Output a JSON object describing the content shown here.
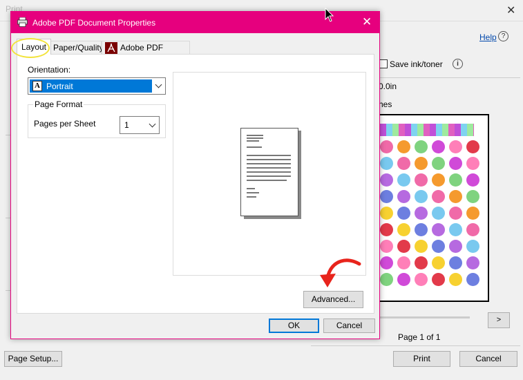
{
  "print_dialog": {
    "title": "Print",
    "close_symbol": "✕",
    "help_label": "Help",
    "help_icon": "?",
    "save_ink_label": "Save ink/toner",
    "info_icon": "i",
    "size_line1": "0.0in",
    "size_line2": "hes",
    "next_label": ">",
    "page_info": "Page 1 of 1",
    "page_setup_label": "Page Setup...",
    "print_label": "Print",
    "cancel_label": "Cancel"
  },
  "pdf_dialog": {
    "title": "Adobe PDF Document Properties",
    "close_symbol": "✕",
    "tabs": [
      {
        "label": "Layout",
        "active": true
      },
      {
        "label": "Paper/Quality",
        "active": false
      },
      {
        "label": "Adobe PDF Settings",
        "active": false
      }
    ],
    "orientation_label": "Orientation:",
    "orientation_icon_letter": "A",
    "orientation_value": "Portrait",
    "page_format_label": "Page Format",
    "pages_per_sheet_label": "Pages per Sheet",
    "pages_per_sheet_value": "1",
    "advanced_label": "Advanced...",
    "ok_label": "OK",
    "cancel_label": "Cancel"
  },
  "colors": {
    "titlebar": "#e6007e",
    "selection": "#0078d7",
    "highlight_ring": "#f2e33b",
    "annotation_arrow": "#e8241c"
  },
  "icons": {
    "printer": "printer-icon",
    "adobe": "adobe-pdf-icon",
    "orientation": "portrait-orientation-icon",
    "cursor": "mouse-cursor-icon"
  }
}
